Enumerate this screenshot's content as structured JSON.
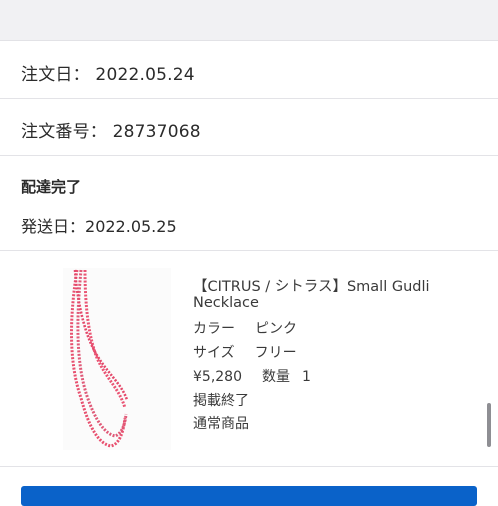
{
  "order": {
    "date_label": "注文日：",
    "date_value": "2022.05.24",
    "number_label": "注文番号：",
    "number_value": "28737068"
  },
  "status": {
    "title": "配達完了",
    "ship_label": "発送日：",
    "ship_value": "2022.05.25"
  },
  "product": {
    "name_line1": "【CITRUS / シトラス】Small Gudli",
    "name_line2": "Necklace",
    "color_label": "カラー",
    "color_value": "ピンク",
    "size_label": "サイズ",
    "size_value": "フリー",
    "price": "¥5,280",
    "qty_label": "数量",
    "qty_value": "1",
    "listing_status": "掲載終了",
    "product_type": "通常商品",
    "image_icon": "pink-bead-necklace"
  },
  "colors": {
    "accent": "#0a62c9",
    "necklace": "#e8506f"
  }
}
